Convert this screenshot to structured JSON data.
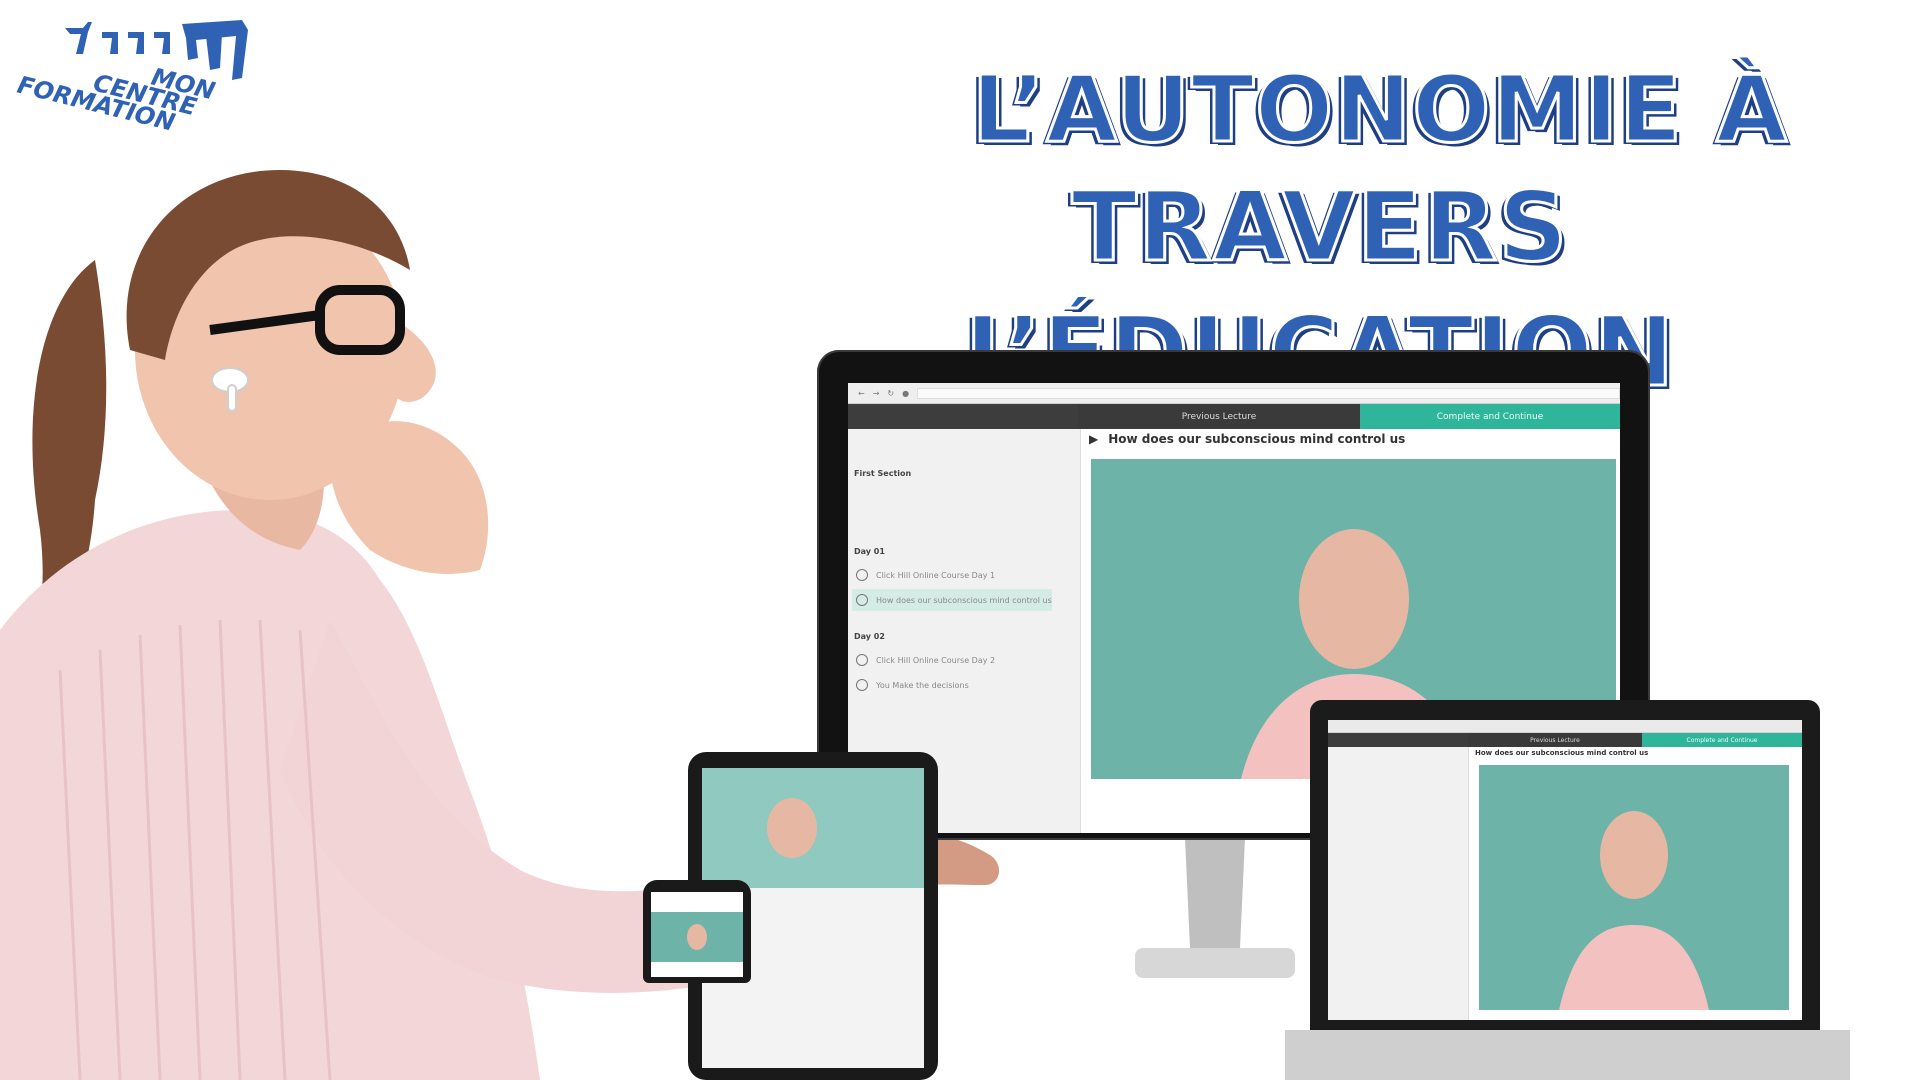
{
  "logo": {
    "text_lines": [
      "MON",
      "CENTRE",
      "FORMATION"
    ],
    "color": "#2f62b5"
  },
  "headline": {
    "line1": "L’AUTONOMIE À",
    "line2": "TRAVERS L’ÉDUCATION",
    "color": "#2f62b5",
    "shadow_color": "#1f3f84"
  },
  "monitor": {
    "previous_lecture_label": "Previous Lecture",
    "complete_label": "Complete and Continue",
    "lecture_title": "How does our subconscious mind control us",
    "sections": [
      {
        "title": "First Section",
        "lessons": []
      },
      {
        "title": "Day 01",
        "lessons": [
          {
            "label": "Click Hill Online Course Day 1",
            "active": false
          },
          {
            "label": "How does our subconscious mind control us",
            "active": true
          }
        ]
      },
      {
        "title": "Day 02",
        "lessons": [
          {
            "label": "Click Hill Online Course Day 2",
            "active": false
          },
          {
            "label": "You Make the decisions",
            "active": false
          }
        ]
      }
    ]
  },
  "laptop": {
    "lecture_title": "How does our subconscious mind control us",
    "previous_lecture_label": "Previous Lecture",
    "complete_label": "Complete and Continue"
  },
  "colors": {
    "brand_blue": "#2f62b5",
    "accent_teal": "#2fb59a",
    "video_bg": "#6db3a8",
    "shirt_pink": "#f2d7d8"
  }
}
